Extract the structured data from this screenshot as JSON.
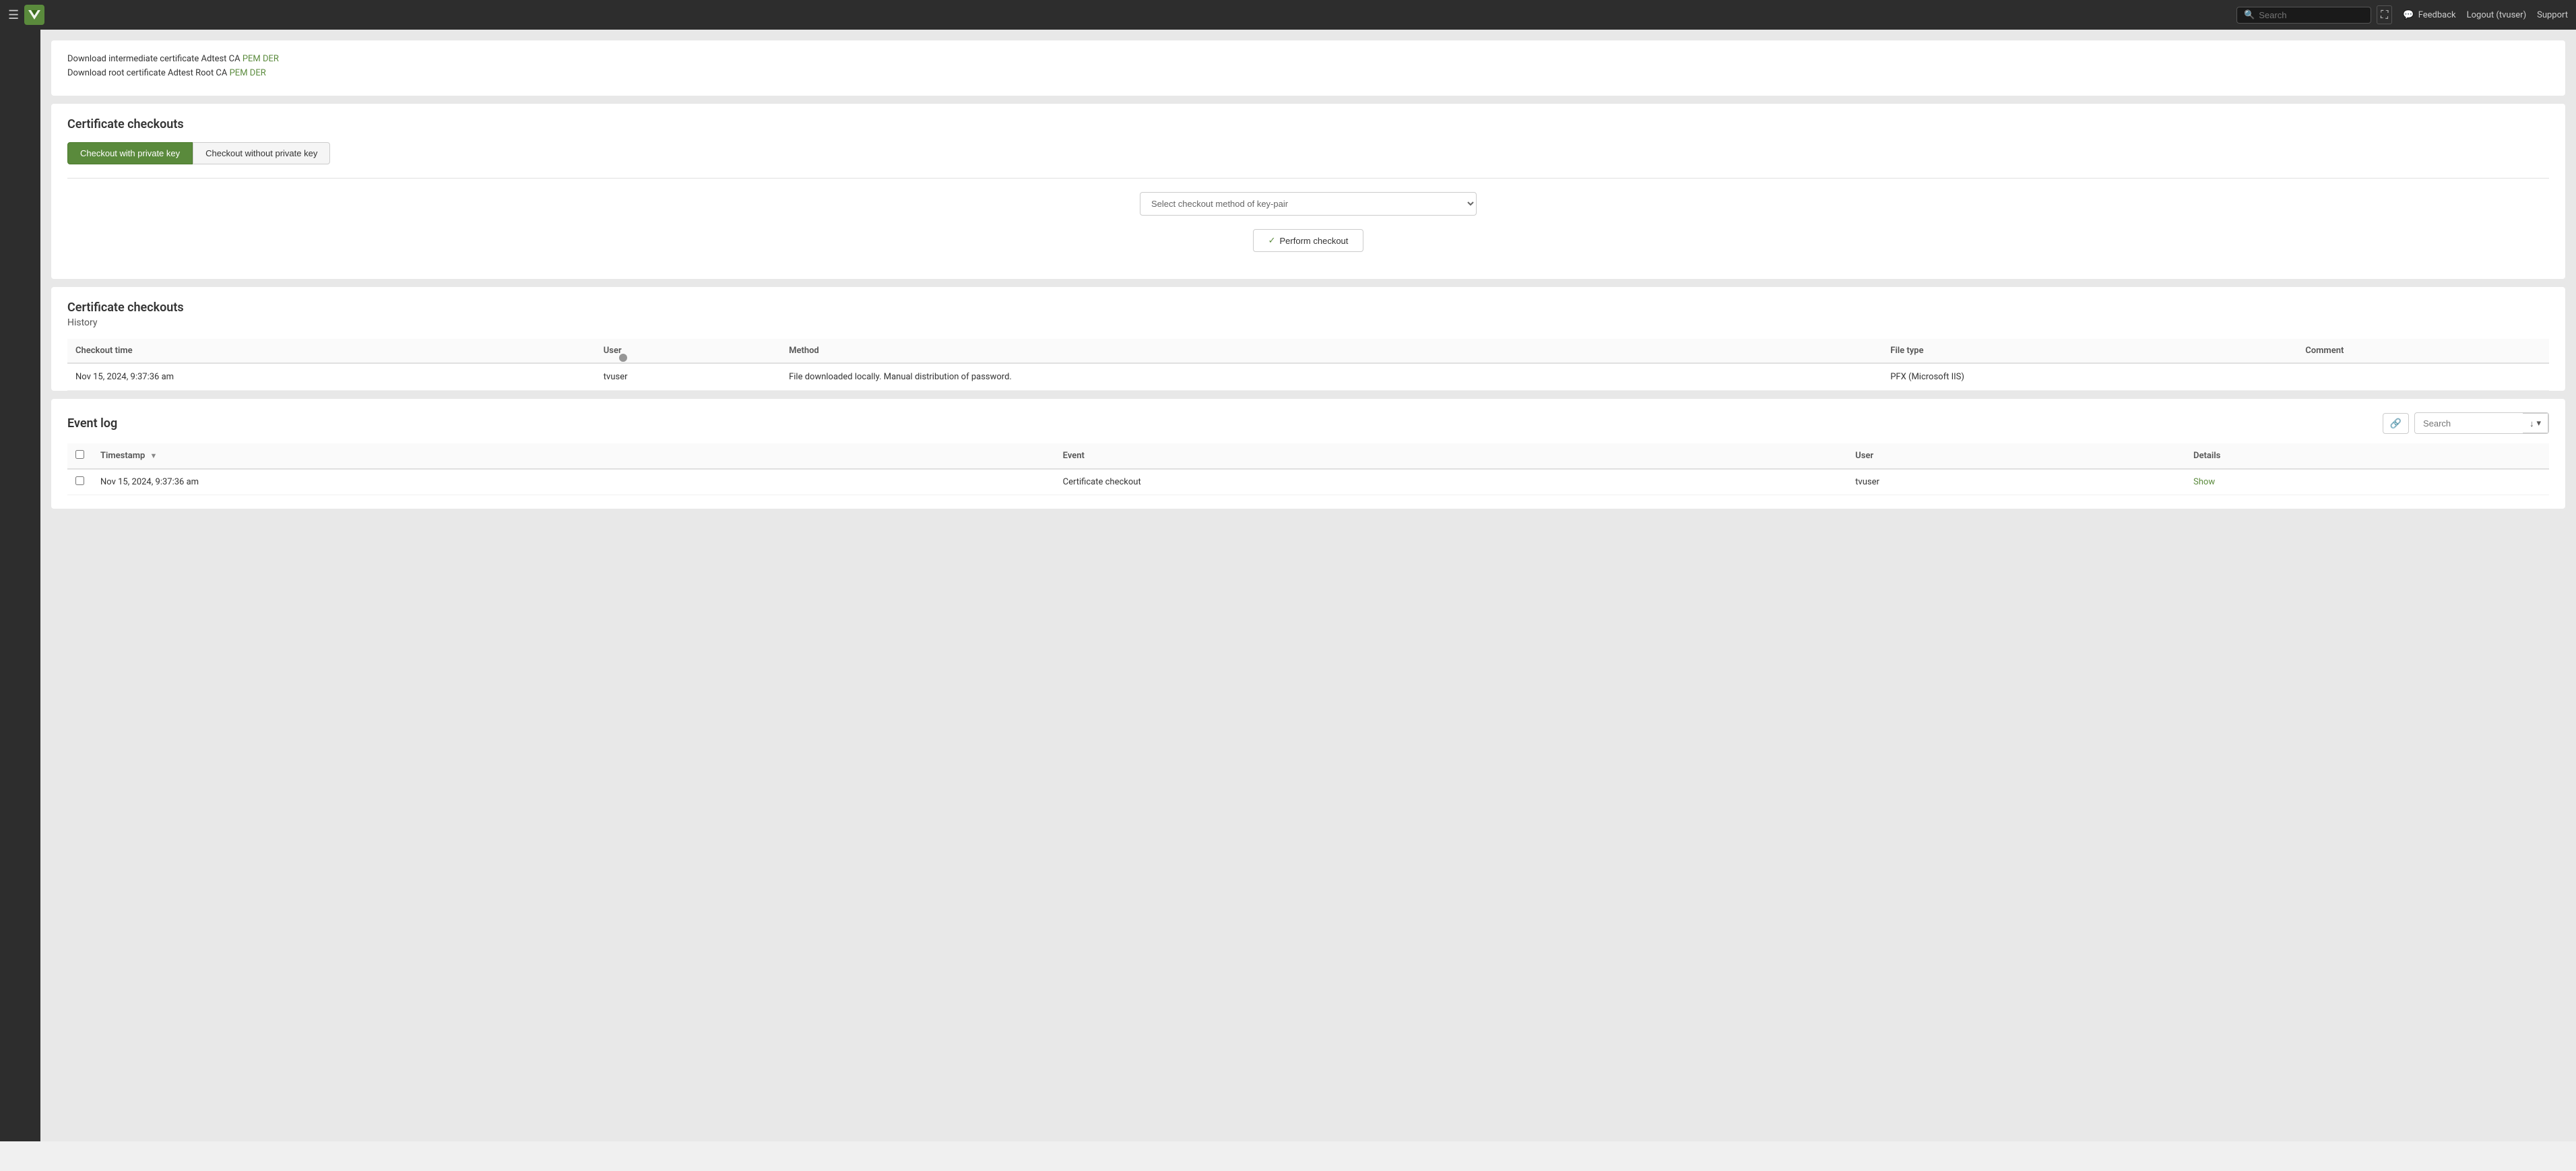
{
  "topbar": {
    "menu_label": "☰",
    "search_placeholder": "Search",
    "expand_icon": "⛶",
    "feedback_icon": "💬",
    "feedback_label": "Feedback",
    "logout_label": "Logout (tvuser)",
    "support_label": "Support"
  },
  "cert_downloads": {
    "intermediate_prefix": "Download intermediate certificate Adtest CA ",
    "intermediate_pem": "PEM",
    "intermediate_der": "DER",
    "root_prefix": "Download root certificate Adtest Root CA ",
    "root_pem": "PEM",
    "root_der": "DER"
  },
  "checkout_card": {
    "title": "Certificate checkouts",
    "tab_with_key": "Checkout with private key",
    "tab_without_key": "Checkout without private key",
    "select_placeholder": "Select checkout method of key-pair",
    "perform_btn": "Perform checkout",
    "check_icon": "✓"
  },
  "history_card": {
    "title": "Certificate checkouts",
    "subtitle": "History",
    "columns": {
      "checkout_time": "Checkout time",
      "user": "User",
      "method": "Method",
      "file_type": "File type",
      "comment": "Comment"
    },
    "rows": [
      {
        "checkout_time": "Nov 15, 2024, 9:37:36 am",
        "user": "tvuser",
        "method": "File downloaded locally. Manual distribution of password.",
        "file_type": "PFX (Microsoft IIS)",
        "comment": ""
      }
    ]
  },
  "event_log": {
    "title": "Event log",
    "link_icon": "🔗",
    "search_placeholder": "Search",
    "download_icon": "↓",
    "dropdown_icon": "▾",
    "columns": {
      "timestamp": "Timestamp",
      "event": "Event",
      "user": "User",
      "details": "Details"
    },
    "rows": [
      {
        "timestamp": "Nov 15, 2024, 9:37:36 am",
        "event": "Certificate checkout",
        "user": "tvuser",
        "details": "Show"
      }
    ]
  }
}
